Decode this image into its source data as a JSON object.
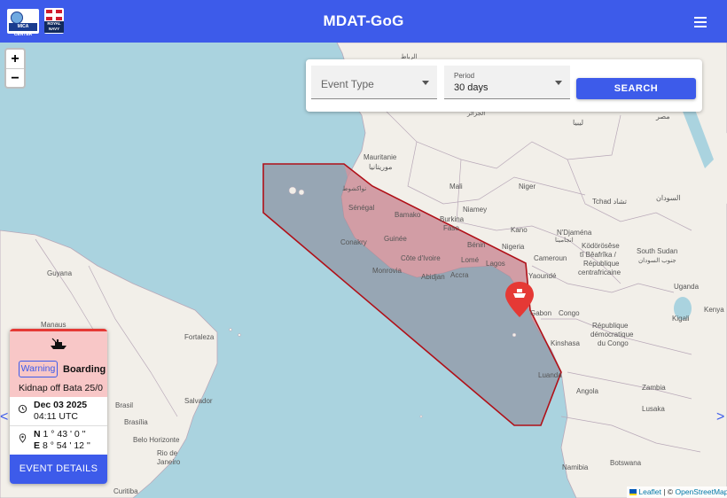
{
  "header": {
    "title": "MDAT-GoG",
    "logo_left_text": "MICA CENTER",
    "logo_right_text": "ROYAL NAVY"
  },
  "zoom": {
    "in": "+",
    "out": "−"
  },
  "filters": {
    "event_type_placeholder": "Event Type",
    "period_label": "Period",
    "period_value": "30 days",
    "search_label": "SEARCH"
  },
  "event_card": {
    "level": "Warning",
    "type": "Boarding",
    "summary": "Kidnap off Bata 25/0",
    "date": "Dec 03 2025",
    "time": "04:11 UTC",
    "lat_dir": "N",
    "lat": "1 ° 43 ' 0 ''",
    "lon_dir": "E",
    "lon": "8 ° 54 ' 12 ''",
    "details_button": "EVENT DETAILS"
  },
  "nav": {
    "prev": "<",
    "next": ">"
  },
  "attribution": {
    "leaflet": "Leaflet",
    "separator": "| ©",
    "osm": "OpenStreetMap"
  },
  "colors": {
    "primary": "#3d5bea",
    "zone_fill": "#8a8a9a",
    "zone_border": "#b01018",
    "marker": "#e53935",
    "card_header": "#f8c7c7"
  },
  "map_labels": {
    "mauritanie": "Mauritanie",
    "mauritanie_ar": "موريتانيا",
    "mali": "Mali",
    "niger": "Niger",
    "tchad": "Tchad تشاد",
    "soudan": "السودان",
    "senegal": "Sénégal",
    "nouakchott": "نواكشوط",
    "bamako": "Bamako",
    "niamey": "Niamey",
    "burkina": "Burkina",
    "faso": "Faso",
    "guinee": "Guinée",
    "conakry": "Conakry",
    "cote": "Côte d'Ivoire",
    "monrovia": "Monrovia",
    "abidjan": "Abidjan",
    "accra": "Accra",
    "lome": "Lomé",
    "lagos": "Lagos",
    "benin": "Bénin",
    "nigeria": "Nigeria",
    "kano": "Kano",
    "ndjamena": "N'Djaména",
    "ndjamena_ar": "انجامينا",
    "cameroun": "Cameroun",
    "yaounde": "Yaoundé",
    "rca1": "Ködörösêse",
    "rca2": "tî Bêafrîka /",
    "rca3": "République",
    "rca4": "centrafricaine",
    "south_sudan": "South Sudan",
    "south_sudan_ar": "جنوب السودان",
    "gabon": "Gabon",
    "congo": "Congo",
    "kinshasa": "Kinshasa",
    "rdc1": "République",
    "rdc2": "démocratique",
    "rdc3": "du Congo",
    "luanda": "Luanda",
    "angola": "Angola",
    "lusaka": "Lusaka",
    "zambia": "Zambia",
    "botswana": "Botswana",
    "namibia": "Namibia",
    "uganda": "Uganda",
    "kenya": "Kenya",
    "manaus": "Manaus",
    "guyana": "Guyana",
    "fortaleza": "Fortaleza",
    "brasil": "Brasil",
    "brasilia": "Brasília",
    "salvador": "Salvador",
    "belo": "Belo Horizonte",
    "rio1": "Rio de",
    "rio2": "Janeiro",
    "curitiba": "Curitiba",
    "alger": "الجزائر",
    "libya": "ليبيا",
    "egypt": "مصر",
    "rabat": "الرباط",
    "kigali": "Kigali"
  }
}
